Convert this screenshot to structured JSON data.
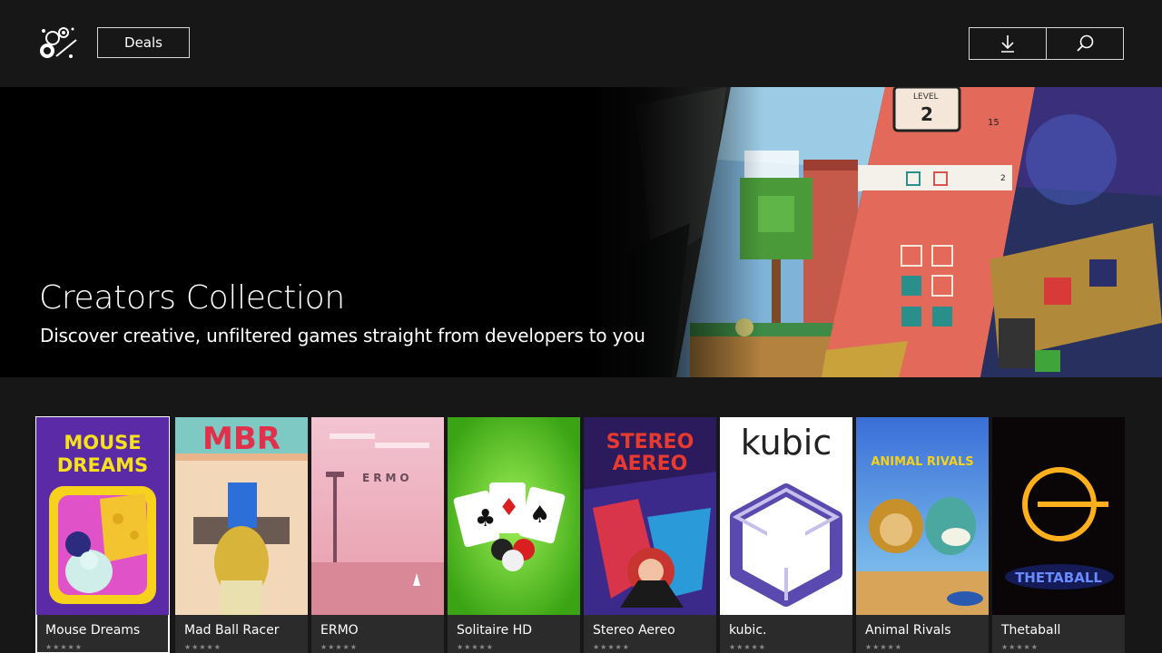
{
  "header": {
    "deals_label": "Deals",
    "download_icon": "download-icon",
    "search_icon": "search-icon"
  },
  "hero": {
    "title": "Creators Collection",
    "subtitle": "Discover creative, unfiltered games straight from developers to you",
    "level_label": "LEVEL",
    "level_value": "2",
    "bolt_value": "15",
    "progress_value": "2"
  },
  "games": [
    {
      "title": "Mouse Dreams",
      "rating_stars": "★★★★★",
      "art_text": "MOUSE DREAMS"
    },
    {
      "title": "Mad Ball Racer",
      "rating_stars": "★★★★★",
      "art_text": "MBR"
    },
    {
      "title": "ERMO",
      "rating_stars": "★★★★★",
      "art_text": "ERMO"
    },
    {
      "title": "Solitaire HD",
      "rating_stars": "★★★★★",
      "art_text": ""
    },
    {
      "title": "Stereo Aereo",
      "rating_stars": "★★★★★",
      "art_text": "STEREO AEREO"
    },
    {
      "title": "kubic.",
      "rating_stars": "★★★★★",
      "art_text": "kubic"
    },
    {
      "title": "Animal Rivals",
      "rating_stars": "★★★★★",
      "art_text": "ANIMAL RIVALS"
    },
    {
      "title": "Thetaball",
      "rating_stars": "★★★★★",
      "art_text": "THETABALL"
    }
  ],
  "colors": {
    "background": "#171717",
    "hero_background": "#000000",
    "border": "#d8d8d8",
    "selection": "#ffffff"
  }
}
